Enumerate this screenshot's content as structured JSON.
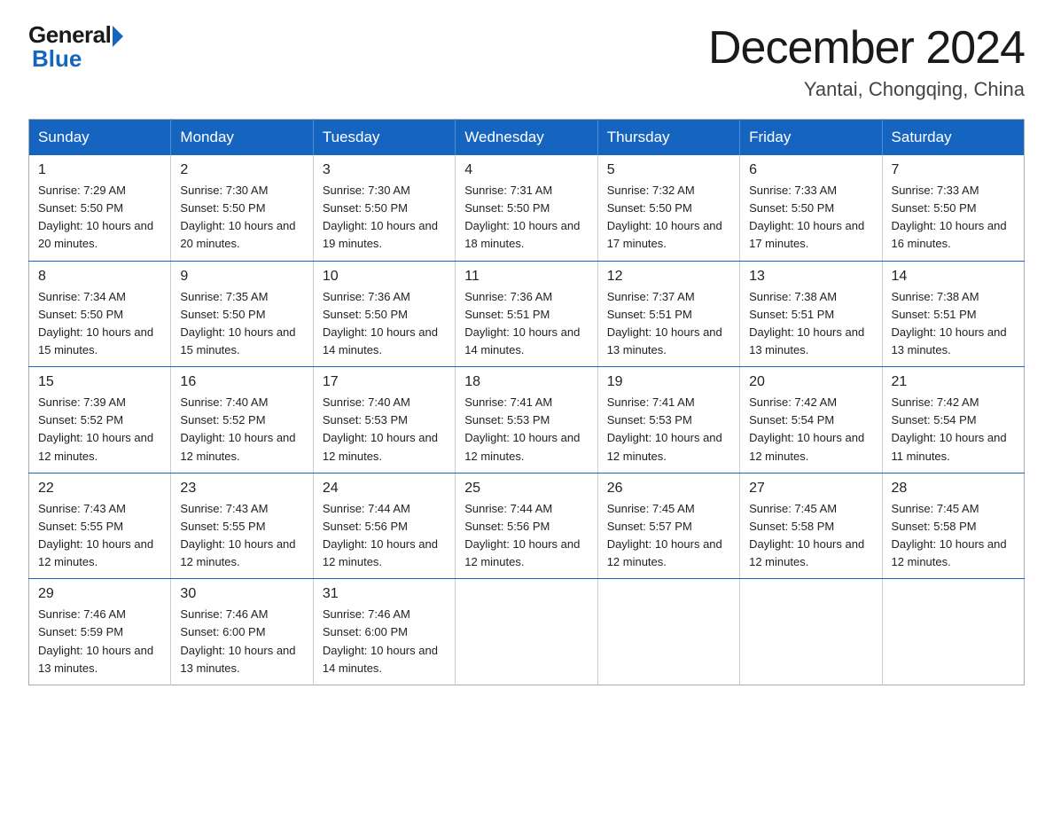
{
  "logo": {
    "general": "General",
    "blue": "Blue"
  },
  "title": "December 2024",
  "location": "Yantai, Chongqing, China",
  "days_of_week": [
    "Sunday",
    "Monday",
    "Tuesday",
    "Wednesday",
    "Thursday",
    "Friday",
    "Saturday"
  ],
  "weeks": [
    [
      {
        "day": 1,
        "sunrise": "7:29 AM",
        "sunset": "5:50 PM",
        "daylight": "10 hours and 20 minutes."
      },
      {
        "day": 2,
        "sunrise": "7:30 AM",
        "sunset": "5:50 PM",
        "daylight": "10 hours and 20 minutes."
      },
      {
        "day": 3,
        "sunrise": "7:30 AM",
        "sunset": "5:50 PM",
        "daylight": "10 hours and 19 minutes."
      },
      {
        "day": 4,
        "sunrise": "7:31 AM",
        "sunset": "5:50 PM",
        "daylight": "10 hours and 18 minutes."
      },
      {
        "day": 5,
        "sunrise": "7:32 AM",
        "sunset": "5:50 PM",
        "daylight": "10 hours and 17 minutes."
      },
      {
        "day": 6,
        "sunrise": "7:33 AM",
        "sunset": "5:50 PM",
        "daylight": "10 hours and 17 minutes."
      },
      {
        "day": 7,
        "sunrise": "7:33 AM",
        "sunset": "5:50 PM",
        "daylight": "10 hours and 16 minutes."
      }
    ],
    [
      {
        "day": 8,
        "sunrise": "7:34 AM",
        "sunset": "5:50 PM",
        "daylight": "10 hours and 15 minutes."
      },
      {
        "day": 9,
        "sunrise": "7:35 AM",
        "sunset": "5:50 PM",
        "daylight": "10 hours and 15 minutes."
      },
      {
        "day": 10,
        "sunrise": "7:36 AM",
        "sunset": "5:50 PM",
        "daylight": "10 hours and 14 minutes."
      },
      {
        "day": 11,
        "sunrise": "7:36 AM",
        "sunset": "5:51 PM",
        "daylight": "10 hours and 14 minutes."
      },
      {
        "day": 12,
        "sunrise": "7:37 AM",
        "sunset": "5:51 PM",
        "daylight": "10 hours and 13 minutes."
      },
      {
        "day": 13,
        "sunrise": "7:38 AM",
        "sunset": "5:51 PM",
        "daylight": "10 hours and 13 minutes."
      },
      {
        "day": 14,
        "sunrise": "7:38 AM",
        "sunset": "5:51 PM",
        "daylight": "10 hours and 13 minutes."
      }
    ],
    [
      {
        "day": 15,
        "sunrise": "7:39 AM",
        "sunset": "5:52 PM",
        "daylight": "10 hours and 12 minutes."
      },
      {
        "day": 16,
        "sunrise": "7:40 AM",
        "sunset": "5:52 PM",
        "daylight": "10 hours and 12 minutes."
      },
      {
        "day": 17,
        "sunrise": "7:40 AM",
        "sunset": "5:53 PM",
        "daylight": "10 hours and 12 minutes."
      },
      {
        "day": 18,
        "sunrise": "7:41 AM",
        "sunset": "5:53 PM",
        "daylight": "10 hours and 12 minutes."
      },
      {
        "day": 19,
        "sunrise": "7:41 AM",
        "sunset": "5:53 PM",
        "daylight": "10 hours and 12 minutes."
      },
      {
        "day": 20,
        "sunrise": "7:42 AM",
        "sunset": "5:54 PM",
        "daylight": "10 hours and 12 minutes."
      },
      {
        "day": 21,
        "sunrise": "7:42 AM",
        "sunset": "5:54 PM",
        "daylight": "10 hours and 11 minutes."
      }
    ],
    [
      {
        "day": 22,
        "sunrise": "7:43 AM",
        "sunset": "5:55 PM",
        "daylight": "10 hours and 12 minutes."
      },
      {
        "day": 23,
        "sunrise": "7:43 AM",
        "sunset": "5:55 PM",
        "daylight": "10 hours and 12 minutes."
      },
      {
        "day": 24,
        "sunrise": "7:44 AM",
        "sunset": "5:56 PM",
        "daylight": "10 hours and 12 minutes."
      },
      {
        "day": 25,
        "sunrise": "7:44 AM",
        "sunset": "5:56 PM",
        "daylight": "10 hours and 12 minutes."
      },
      {
        "day": 26,
        "sunrise": "7:45 AM",
        "sunset": "5:57 PM",
        "daylight": "10 hours and 12 minutes."
      },
      {
        "day": 27,
        "sunrise": "7:45 AM",
        "sunset": "5:58 PM",
        "daylight": "10 hours and 12 minutes."
      },
      {
        "day": 28,
        "sunrise": "7:45 AM",
        "sunset": "5:58 PM",
        "daylight": "10 hours and 12 minutes."
      }
    ],
    [
      {
        "day": 29,
        "sunrise": "7:46 AM",
        "sunset": "5:59 PM",
        "daylight": "10 hours and 13 minutes."
      },
      {
        "day": 30,
        "sunrise": "7:46 AM",
        "sunset": "6:00 PM",
        "daylight": "10 hours and 13 minutes."
      },
      {
        "day": 31,
        "sunrise": "7:46 AM",
        "sunset": "6:00 PM",
        "daylight": "10 hours and 14 minutes."
      },
      null,
      null,
      null,
      null
    ]
  ]
}
